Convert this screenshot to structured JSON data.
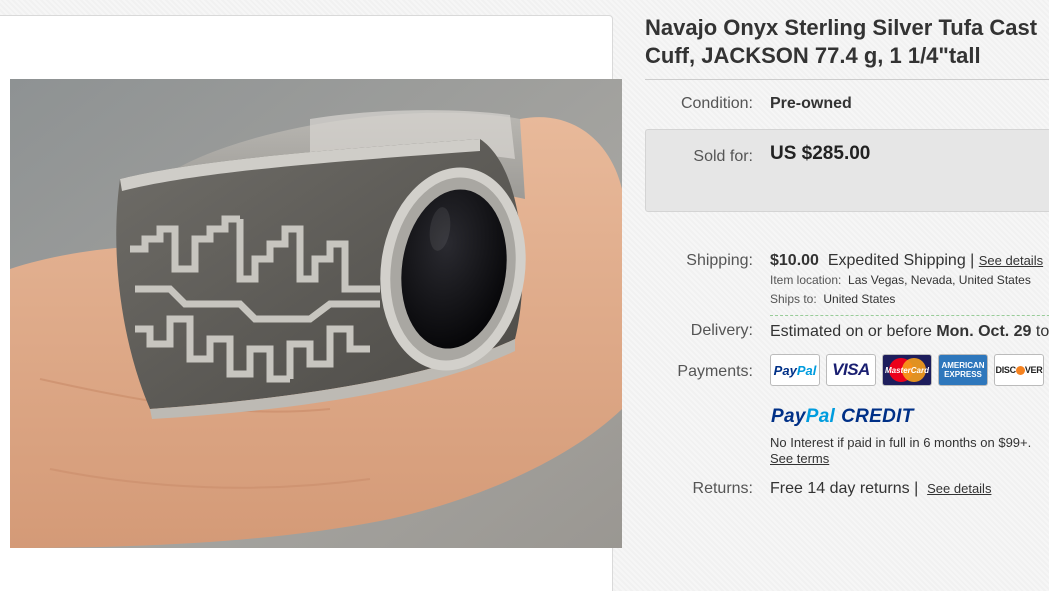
{
  "listing": {
    "title_line1": "Navajo Onyx Sterling Silver Tufa Cast",
    "title_line2": "Cuff, JACKSON 77.4 g, 1 1/4\"tall"
  },
  "condition": {
    "label": "Condition:",
    "value": "Pre-owned"
  },
  "sold": {
    "label": "Sold for:",
    "price": "US $285.00"
  },
  "shipping": {
    "label": "Shipping:",
    "cost": "$10.00",
    "method": "Expedited Shipping |",
    "see_details": "See details",
    "location_label": "Item location:",
    "location_value": "Las Vegas, Nevada, United States",
    "ships_to_label": "Ships to:",
    "ships_to_value": "United States"
  },
  "delivery": {
    "label": "Delivery:",
    "prefix": "Estimated on or before",
    "date": "Mon. Oct. 29",
    "suffix": "to"
  },
  "payments": {
    "label": "Payments:",
    "cards": {
      "paypal_pay": "Pay",
      "paypal_pal": "Pal",
      "visa": "VISA",
      "mastercard": "MasterCard",
      "amex_line1": "AMERICAN",
      "amex_line2": "EXPRESS",
      "discover_a": "DISC",
      "discover_b": "VER"
    },
    "credit_pay": "Pay",
    "credit_pal": "Pal",
    "credit_word": "CREDIT",
    "credit_terms": "No Interest if paid in full in 6 months on $99+.",
    "see_terms": "See terms"
  },
  "returns": {
    "label": "Returns:",
    "value": "Free 14 day returns |",
    "see_details": "See details"
  },
  "colors": {
    "paypal_dark": "#003087",
    "paypal_light": "#009cde",
    "sold_box_bg": "#e6e6e6"
  }
}
